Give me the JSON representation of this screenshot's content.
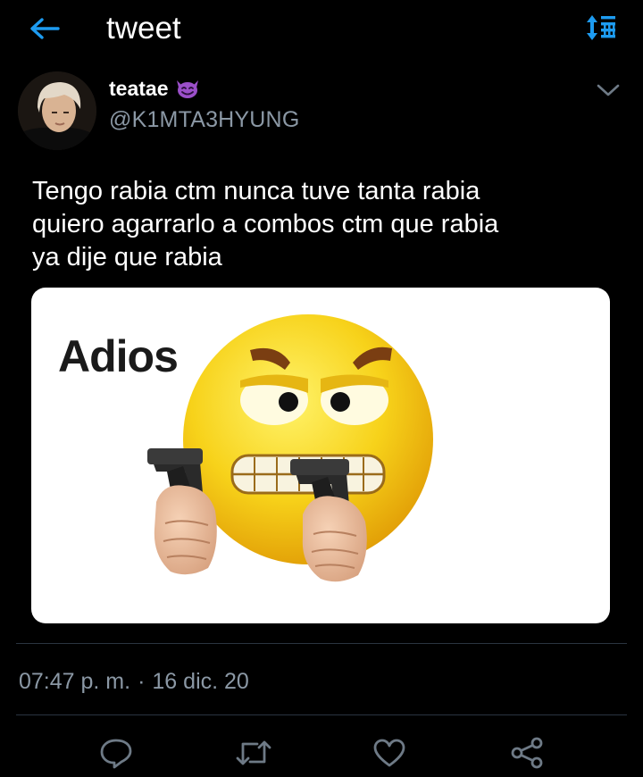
{
  "header": {
    "title": "tweet",
    "back_icon": "arrow-left-icon",
    "sort_icon": "sort-icon"
  },
  "author": {
    "display_name": "teatae",
    "name_emoji_icon": "smiling-devil-icon",
    "handle": "@K1MTA3HYUNG",
    "avatar": "profile-photo"
  },
  "tweet": {
    "text_lines": [
      "Tengo rabia ctm nunca tuve tanta rabia",
      "quiero agarrarlo a combos ctm que rabia",
      "ya dije que rabia"
    ],
    "media_caption": "Adios"
  },
  "meta": {
    "time": "07:47 p. m.",
    "separator": "·",
    "date": "16 dic. 20"
  },
  "actions": {
    "reply_icon": "reply-icon",
    "retweet_icon": "retweet-icon",
    "like_icon": "heart-icon",
    "share_icon": "share-icon"
  },
  "colors": {
    "background": "#000000",
    "accent": "#1d9bf0",
    "secondary_text": "#8b98a5",
    "divider": "#2a3440"
  }
}
